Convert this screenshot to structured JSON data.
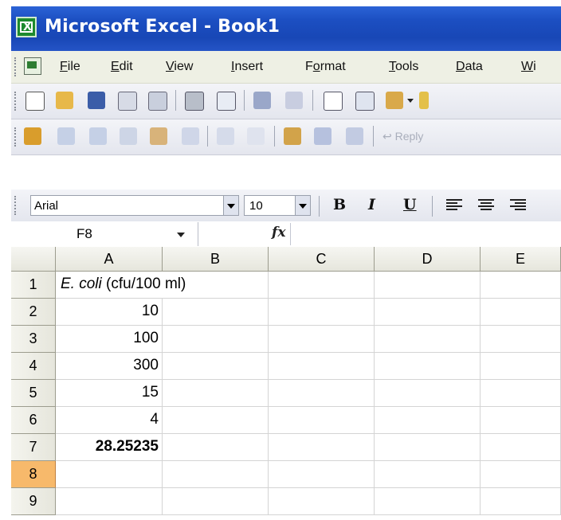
{
  "window": {
    "title": "Microsoft Excel - Book1"
  },
  "menu": [
    {
      "pre": "",
      "u": "F",
      "post": "ile"
    },
    {
      "pre": "",
      "u": "E",
      "post": "dit"
    },
    {
      "pre": "",
      "u": "V",
      "post": "iew"
    },
    {
      "pre": "",
      "u": "I",
      "post": "nsert"
    },
    {
      "pre": "F",
      "u": "o",
      "post": "rmat"
    },
    {
      "pre": "",
      "u": "T",
      "post": "ools"
    },
    {
      "pre": "",
      "u": "D",
      "post": "ata"
    },
    {
      "pre": "",
      "u": "W",
      "post": "i"
    }
  ],
  "toolbar": {
    "reply_label": "Reply"
  },
  "format_bar": {
    "font": "Arial",
    "size": "10",
    "bold": "B",
    "italic": "I",
    "underline": "U"
  },
  "formula_bar": {
    "name_box": "F8",
    "fx": "fx",
    "content": ""
  },
  "grid": {
    "columns": [
      "A",
      "B",
      "C",
      "D",
      "E"
    ],
    "rows": [
      "1",
      "2",
      "3",
      "4",
      "5",
      "6",
      "7",
      "8",
      "9"
    ],
    "selected_row": "8",
    "a1_italic": "E. coli",
    "a1_rest": " (cfu/100 ml)",
    "column_a": [
      "",
      "10",
      "100",
      "300",
      "15",
      "4",
      "28.25235",
      "",
      ""
    ]
  },
  "colors": {
    "title_bar": "#1c4fc2",
    "selected_row_header": "#f7b96b",
    "menu_bar": "#eef0e4"
  }
}
